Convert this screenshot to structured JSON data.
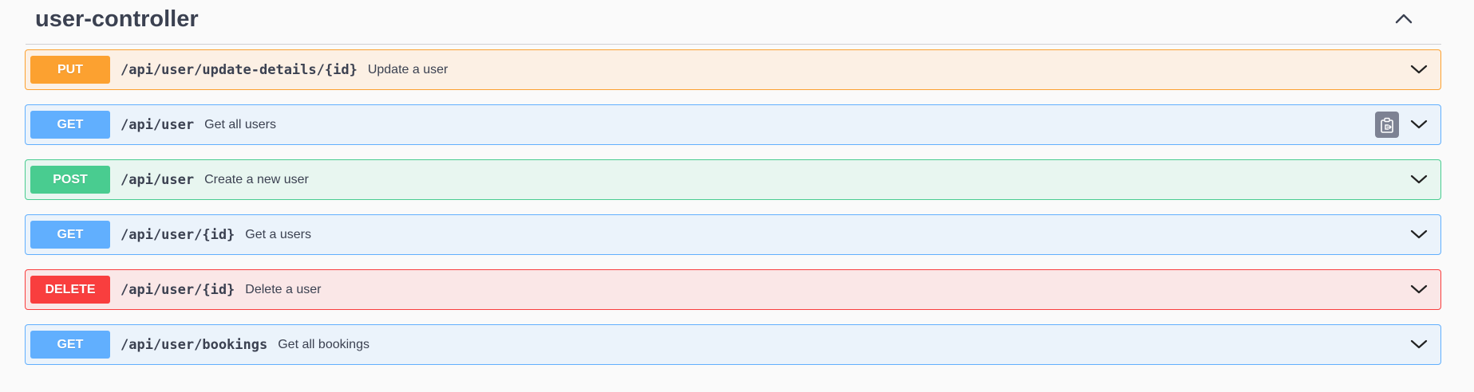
{
  "section": {
    "title": "user-controller",
    "toggle_icon": "chevron-up-icon"
  },
  "operations": [
    {
      "method": "PUT",
      "path": "/api/user/update-details/{id}",
      "summary": "Update a user",
      "color": "#fca130",
      "background": "#fcf0e4",
      "expand_icon": "chevron-down-icon"
    },
    {
      "method": "GET",
      "path": "/api/user",
      "summary": "Get all users",
      "color": "#61affe",
      "background": "#ebf3fb",
      "expand_icon": "chevron-down-icon",
      "copy_icon": "copy-to-clipboard-icon"
    },
    {
      "method": "POST",
      "path": "/api/user",
      "summary": "Create a new user",
      "color": "#49cc90",
      "background": "#e8f6f0",
      "expand_icon": "chevron-down-icon"
    },
    {
      "method": "GET",
      "path": "/api/user/{id}",
      "summary": "Get a users",
      "color": "#61affe",
      "background": "#ebf3fb",
      "expand_icon": "chevron-down-icon"
    },
    {
      "method": "DELETE",
      "path": "/api/user/{id}",
      "summary": "Delete a user",
      "color": "#f93e3e",
      "background": "#fae7e7",
      "expand_icon": "chevron-down-icon"
    },
    {
      "method": "GET",
      "path": "/api/user/bookings",
      "summary": "Get all bookings",
      "color": "#61affe",
      "background": "#ebf3fb",
      "expand_icon": "chevron-down-icon"
    }
  ]
}
